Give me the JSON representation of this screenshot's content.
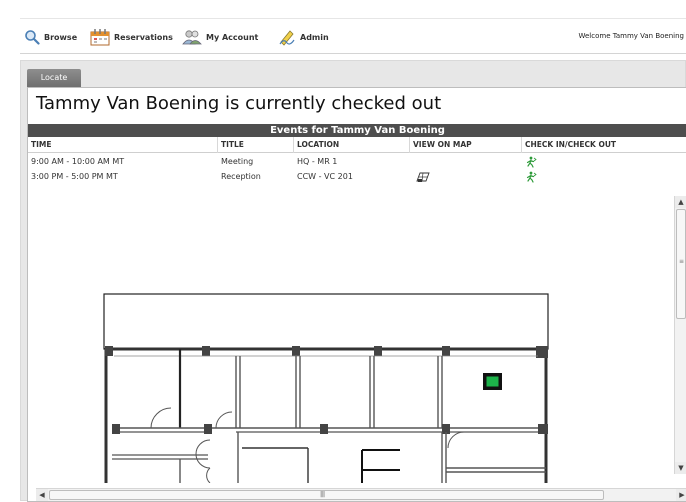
{
  "nav": {
    "items": [
      {
        "label": "Browse",
        "icon": "search-icon"
      },
      {
        "label": "Reservations",
        "icon": "calendar-icon"
      },
      {
        "label": "My Account",
        "icon": "people-icon"
      },
      {
        "label": "Admin",
        "icon": "pencil-icon"
      }
    ],
    "welcome": "Welcome Tammy Van Boening"
  },
  "tab": {
    "label": "Locate"
  },
  "status": {
    "title": "Tammy Van Boening is currently checked out"
  },
  "events": {
    "header": "Events for Tammy Van Boening",
    "columns": [
      "TIME",
      "TITLE",
      "LOCATION",
      "VIEW ON MAP",
      "CHECK IN/CHECK OUT"
    ],
    "rows": [
      {
        "time": "9:00 AM - 10:00 AM MT",
        "title": "Meeting",
        "location": "HQ - MR 1",
        "has_map": false
      },
      {
        "time": "3:00 PM - 5:00 PM MT",
        "title": "Reception",
        "location": "CCW - VC 201",
        "has_map": true
      }
    ]
  },
  "colors": {
    "header_bar": "#4e4e4e",
    "marker": "#1db34a",
    "checkin_icon": "#2e9b3a"
  }
}
